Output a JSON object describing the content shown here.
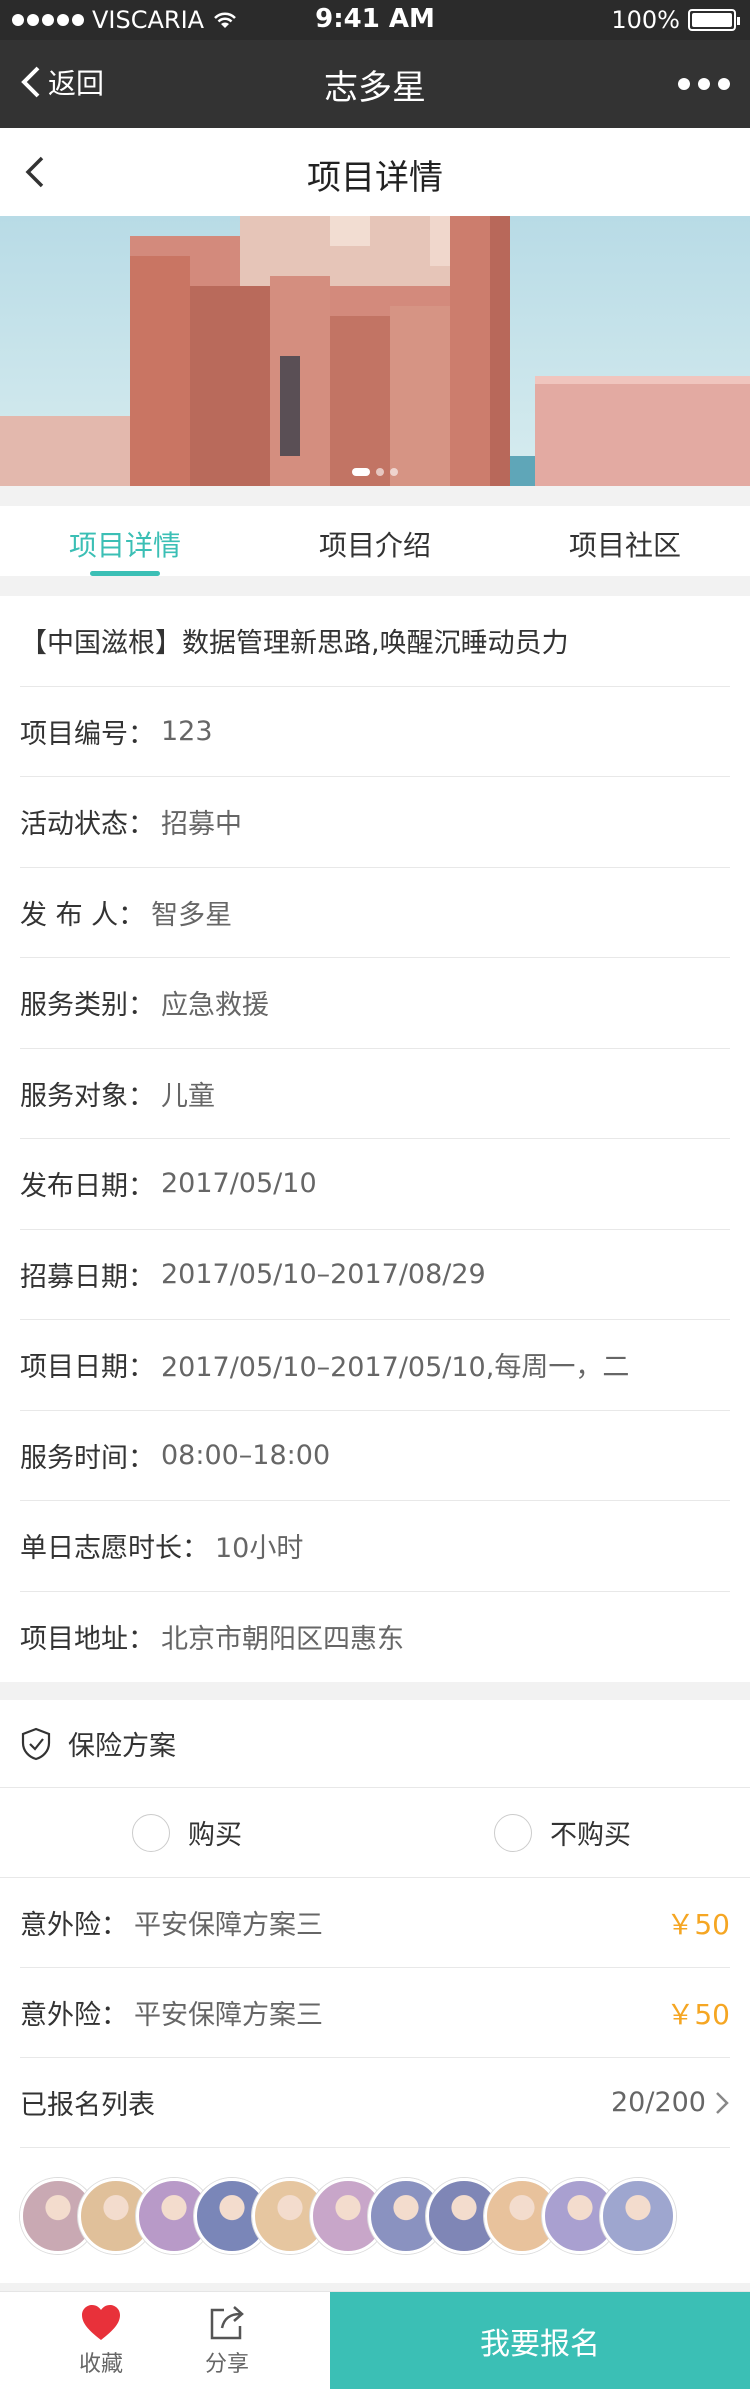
{
  "status": {
    "carrier": "VISCARIA",
    "time": "9:41 AM",
    "battery": "100%",
    "battery_level": 1.0
  },
  "nav": {
    "back_label": "返回",
    "title": "志多星"
  },
  "page": {
    "title": "项目详情"
  },
  "banner": {
    "slides": 3,
    "active": 1
  },
  "tabs": [
    {
      "label": "项目详情",
      "active": true
    },
    {
      "label": "项目介绍",
      "active": false
    },
    {
      "label": "项目社区",
      "active": false
    }
  ],
  "details": {
    "headline": "【中国滋根】数据管理新思路,唤醒沉睡动员力",
    "rows": [
      {
        "label": "项目编号：",
        "value": "123"
      },
      {
        "label": "活动状态：",
        "value": "招募中"
      },
      {
        "label": "发 布 人：",
        "value": "智多星"
      },
      {
        "label": "服务类别：",
        "value": "应急救援"
      },
      {
        "label": "服务对象：",
        "value": "儿童"
      },
      {
        "label": "发布日期：",
        "value": "2017/05/10"
      },
      {
        "label": "招募日期：",
        "value": "2017/05/10–2017/08/29"
      },
      {
        "label": "项目日期：",
        "value": "2017/05/10–2017/05/10,每周一，二"
      },
      {
        "label": "服务时间：",
        "value": "08:00–18:00"
      },
      {
        "label": "单日志愿时长：",
        "value": "10小时"
      },
      {
        "label": "项目地址：",
        "value": "北京市朝阳区四惠东"
      }
    ]
  },
  "insurance": {
    "title": "保险方案",
    "options": [
      "购买",
      "不购买"
    ],
    "plans": [
      {
        "label": "意外险：",
        "value": "平安保障方案三",
        "price": "￥50"
      },
      {
        "label": "意外险：",
        "value": "平安保障方案三",
        "price": "￥50"
      }
    ]
  },
  "signups": {
    "label": "已报名列表",
    "count": "20/200"
  },
  "avatars": [
    {
      "color": "#c9a9b3"
    },
    {
      "color": "#e0c09a"
    },
    {
      "color": "#b89ac8"
    },
    {
      "color": "#7a86b8"
    },
    {
      "color": "#e6c6a0"
    },
    {
      "color": "#c8a6c9"
    },
    {
      "color": "#8a92c0"
    },
    {
      "color": "#7f86b6"
    },
    {
      "color": "#e8c29c"
    },
    {
      "color": "#a9a0d0"
    },
    {
      "color": "#9ea6cf"
    }
  ],
  "bottom": {
    "favorite": "收藏",
    "share": "分享",
    "signup": "我要报名"
  },
  "colors": {
    "accent": "#3bbfb5",
    "price": "#f5a623",
    "favorite": "#e8313a"
  }
}
